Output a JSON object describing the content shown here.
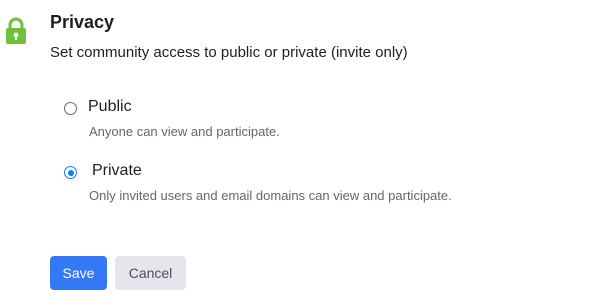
{
  "section": {
    "title": "Privacy",
    "description": "Set community access to public or private (invite only)",
    "icon": "lock-icon",
    "icon_color": "#6fc03b"
  },
  "options": [
    {
      "label": "Public",
      "description": "Anyone can view and participate.",
      "selected": false
    },
    {
      "label": "Private",
      "description": "Only invited users and email domains can view and participate.",
      "selected": true
    }
  ],
  "actions": {
    "save_label": "Save",
    "cancel_label": "Cancel",
    "accent_color": "#3578f6"
  }
}
